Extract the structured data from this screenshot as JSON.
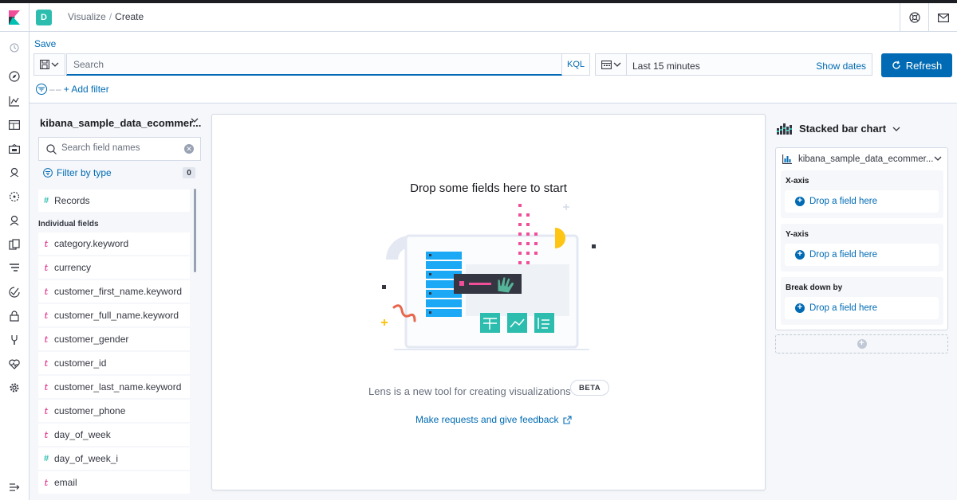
{
  "header": {
    "space_initial": "D",
    "breadcrumbs": [
      "Visualize",
      "Create"
    ]
  },
  "query": {
    "save_label": "Save",
    "search_placeholder": "Search",
    "language_label": "KQL",
    "time_range": "Last 15 minutes",
    "show_dates_label": "Show dates",
    "refresh_label": "Refresh",
    "add_filter_label": "+ Add filter"
  },
  "field_panel": {
    "index_pattern": "kibana_sample_data_ecommer...",
    "search_placeholder": "Search field names",
    "filter_by_type_label": "Filter by type",
    "filter_by_type_count": "0",
    "records_label": "Records",
    "group_label": "Individual fields",
    "fields": [
      {
        "name": "category.keyword",
        "type": "t"
      },
      {
        "name": "currency",
        "type": "t"
      },
      {
        "name": "customer_first_name.keyword",
        "type": "t"
      },
      {
        "name": "customer_full_name.keyword",
        "type": "t"
      },
      {
        "name": "customer_gender",
        "type": "t"
      },
      {
        "name": "customer_id",
        "type": "t"
      },
      {
        "name": "customer_last_name.keyword",
        "type": "t"
      },
      {
        "name": "customer_phone",
        "type": "t"
      },
      {
        "name": "day_of_week",
        "type": "t"
      },
      {
        "name": "day_of_week_i",
        "type": "#"
      },
      {
        "name": "email",
        "type": "t"
      }
    ]
  },
  "workspace": {
    "title": "Drop some fields here to start",
    "description": "Lens is a new tool for creating visualizations",
    "beta_label": "BETA",
    "feedback_link": "Make requests and give feedback"
  },
  "config": {
    "chart_type": "Stacked bar chart",
    "layer_index": "kibana_sample_data_ecommer...",
    "dimensions": [
      {
        "label": "X-axis",
        "drop_label": "Drop a field here"
      },
      {
        "label": "Y-axis",
        "drop_label": "Drop a field here"
      },
      {
        "label": "Break down by",
        "drop_label": "Drop a field here"
      }
    ]
  },
  "colors": {
    "primary": "#006bb4",
    "accent": "#dd0a73",
    "teal": "#2dbdae"
  }
}
